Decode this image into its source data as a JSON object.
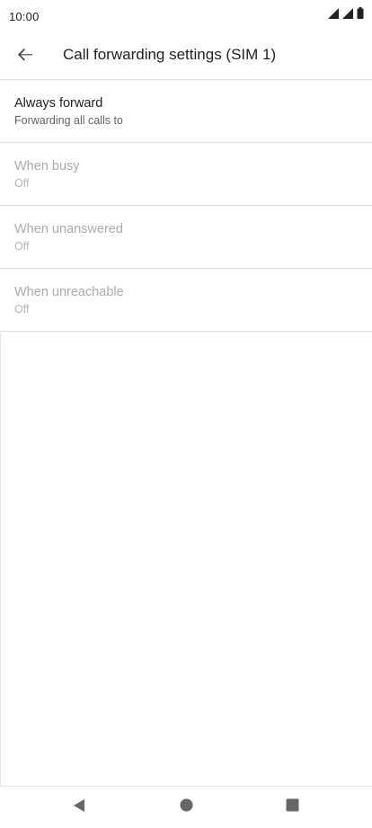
{
  "status_bar": {
    "time": "10:00",
    "icons": [
      "signal-icon",
      "signal-icon",
      "battery-icon"
    ]
  },
  "app_bar": {
    "back_icon": "arrow-back-icon",
    "title": "Call forwarding settings (SIM 1)"
  },
  "settings": {
    "items": [
      {
        "title": "Always forward",
        "summary": "Forwarding all calls to",
        "enabled": true
      },
      {
        "title": "When busy",
        "summary": "Off",
        "enabled": false
      },
      {
        "title": "When unanswered",
        "summary": "Off",
        "enabled": false
      },
      {
        "title": "When unreachable",
        "summary": "Off",
        "enabled": false
      }
    ]
  },
  "nav_bar": {
    "icons": [
      "back-triangle-icon",
      "home-circle-icon",
      "recents-square-icon"
    ]
  },
  "colors": {
    "text_primary": "#202124",
    "text_secondary": "#5f6368",
    "text_disabled": "#a8aaad",
    "divider": "#dadce0",
    "nav_icon": "#666666"
  }
}
